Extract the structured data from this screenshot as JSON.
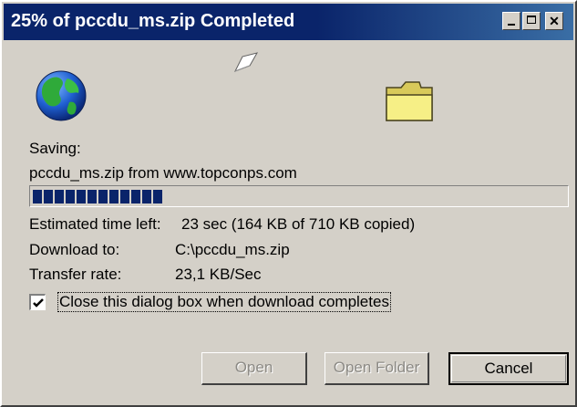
{
  "window": {
    "title": "25% of pccdu_ms.zip Completed",
    "accent_color": "#0a246a",
    "title_buttons": [
      "minimize-icon",
      "maximize-icon",
      "close-icon"
    ]
  },
  "icons": {
    "globe": "globe-icon",
    "paper": "flying-paper-icon",
    "folder": "folder-icon"
  },
  "status": {
    "saving_label": "Saving:",
    "source": "pccdu_ms.zip from www.topconps.com"
  },
  "progress": {
    "fraction": 0.25,
    "blocks_filled": 12
  },
  "details": {
    "estimated_label": "Estimated time left:",
    "estimated_value": "23 sec (164 KB of 710 KB copied)",
    "download_to_label": "Download to:",
    "download_to_value": "C:\\pccdu_ms.zip",
    "transfer_rate_label": "Transfer rate:",
    "transfer_rate_value": "23,1 KB/Sec"
  },
  "checkbox": {
    "checked": true,
    "label": "Close this dialog box when download completes"
  },
  "buttons": {
    "open": "Open",
    "open_folder": "Open Folder",
    "cancel": "Cancel"
  }
}
